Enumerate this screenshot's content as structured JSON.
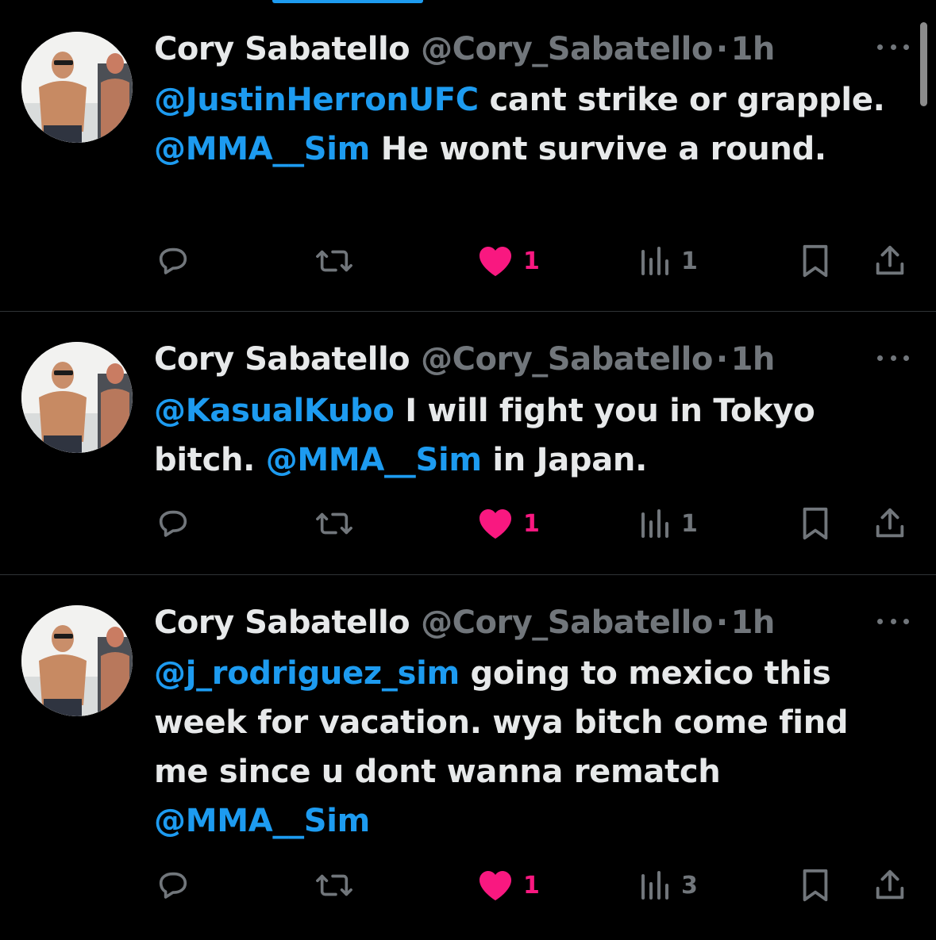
{
  "colors": {
    "background": "#000000",
    "text": "#e7e9ea",
    "muted": "#71767b",
    "link": "#1d9bf0",
    "like": "#f91880",
    "divider": "#2f3336"
  },
  "tweets": [
    {
      "name": "Cory Sabatello",
      "handle": "@Cory_Sabatello",
      "separator": "·",
      "time": "1h",
      "segments": [
        {
          "text": "@JustinHerronUFC",
          "mention": true
        },
        {
          "text": " cant strike or grapple. ",
          "mention": false
        },
        {
          "text": "@MMA__Sim",
          "mention": true
        },
        {
          "text": " He wont survive a round.",
          "mention": false
        }
      ],
      "likes": "1",
      "views": "1",
      "icons": [
        "reply-icon",
        "retweet-icon",
        "heart-icon",
        "views-icon",
        "bookmark-icon",
        "share-icon"
      ]
    },
    {
      "name": "Cory Sabatello",
      "handle": "@Cory_Sabatello",
      "separator": "·",
      "time": "1h",
      "segments": [
        {
          "text": "@KasualKubo",
          "mention": true
        },
        {
          "text": " I will fight you in Tokyo bitch. ",
          "mention": false
        },
        {
          "text": "@MMA__Sim",
          "mention": true
        },
        {
          "text": " in Japan.",
          "mention": false
        }
      ],
      "likes": "1",
      "views": "1",
      "icons": [
        "reply-icon",
        "retweet-icon",
        "heart-icon",
        "views-icon",
        "bookmark-icon",
        "share-icon"
      ]
    },
    {
      "name": "Cory Sabatello",
      "handle": "@Cory_Sabatello",
      "separator": "·",
      "time": "1h",
      "segments": [
        {
          "text": "@j_rodriguez_sim",
          "mention": true
        },
        {
          "text": " going to mexico this week for vacation. wya bitch come find me since u dont wanna rematch ",
          "mention": false
        },
        {
          "text": "@MMA__Sim",
          "mention": true
        }
      ],
      "likes": "1",
      "views": "3",
      "icons": [
        "reply-icon",
        "retweet-icon",
        "heart-icon",
        "views-icon",
        "bookmark-icon",
        "share-icon"
      ]
    }
  ]
}
